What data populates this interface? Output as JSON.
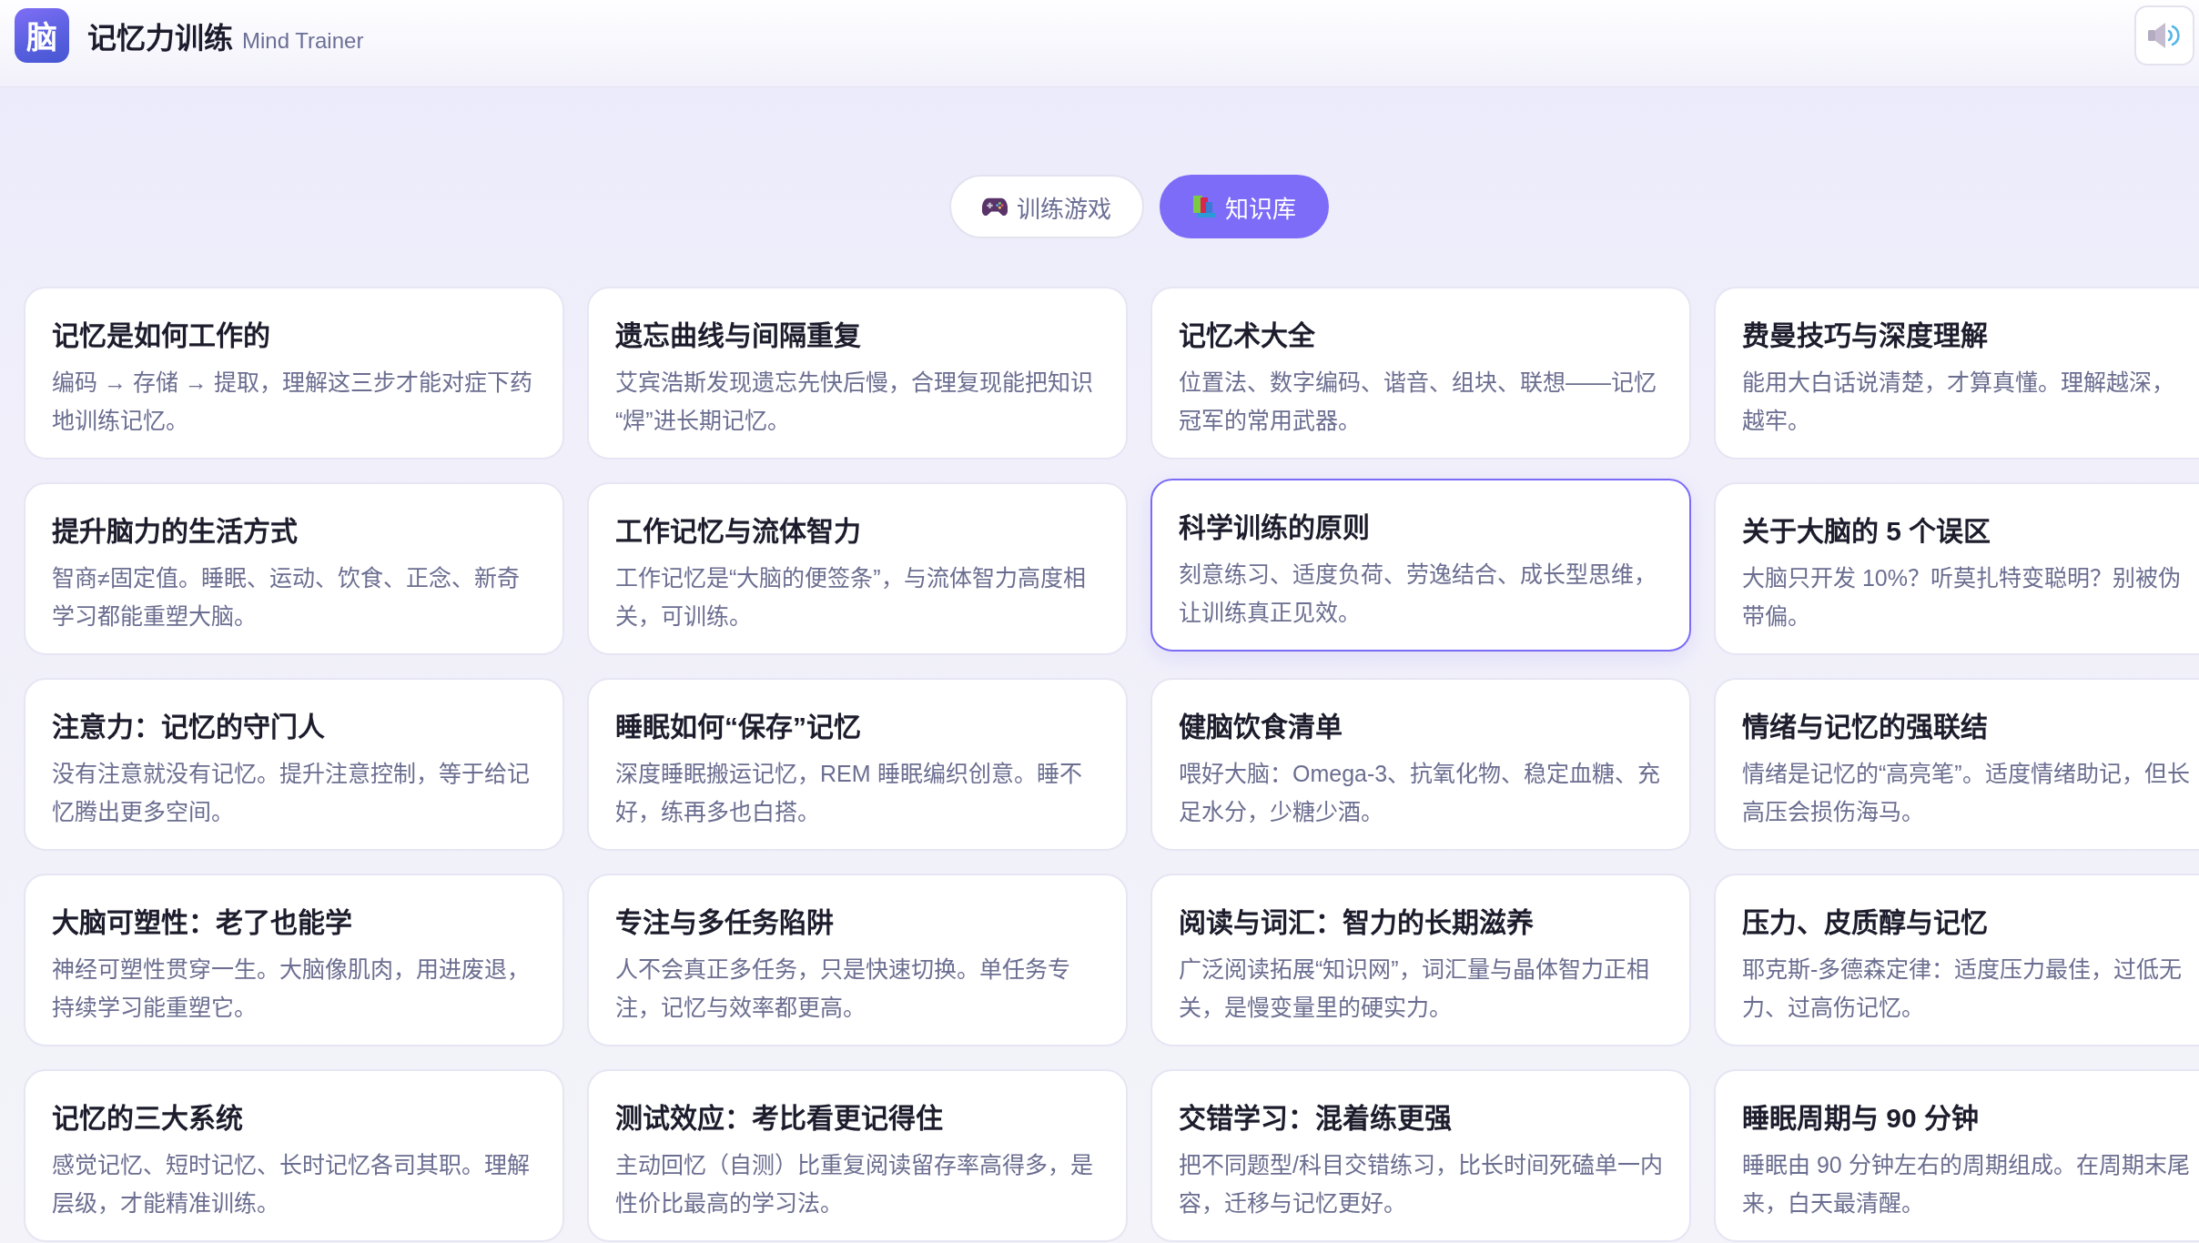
{
  "header": {
    "logo": "脑",
    "title": "记忆力训练",
    "subtitle": "Mind Trainer"
  },
  "tabs": [
    {
      "label": "训练游戏",
      "selected": false
    },
    {
      "label": "知识库",
      "selected": true
    }
  ],
  "cards": [
    {
      "title": "记忆是如何工作的",
      "description": [
        "编码 → 存储 → 提取，理解这三步才能对症下药地训练记忆。"
      ],
      "highlighted": false
    },
    {
      "title": "遗忘曲线与间隔重复",
      "description": [
        "艾宾浩斯发现遗忘先快后慢，合理复现能把知识“焊”进长期记忆。"
      ],
      "highlighted": false
    },
    {
      "title": "记忆术大全",
      "description": [
        "位置法、数字编码、谐音、组块、联想——记忆冠军的常用武器。"
      ],
      "highlighted": false
    },
    {
      "title": "费曼技巧与深度理解",
      "description": [
        "能用大白话说清楚，才算真懂。理解越深，",
        "越牢。"
      ],
      "highlighted": false
    },
    {
      "title": "提升脑力的生活方式",
      "description": [
        "智商≠固定值。睡眠、运动、饮食、正念、新奇学习都能重塑大脑。"
      ],
      "highlighted": false
    },
    {
      "title": "工作记忆与流体智力",
      "description": [
        "工作记忆是“大脑的便签条”，与流体智力高度相关，可训练。"
      ],
      "highlighted": false
    },
    {
      "title": "科学训练的原则",
      "description": [
        "刻意练习、适度负荷、劳逸结合、成长型思维，让训练真正见效。"
      ],
      "highlighted": true
    },
    {
      "title": "关于大脑的 5 个误区",
      "description": [
        "大脑只开发 10%？听莫扎特变聪明？别被伪",
        "带偏。"
      ],
      "highlighted": false
    },
    {
      "title": "注意力：记忆的守门人",
      "description": [
        "没有注意就没有记忆。提升注意控制，等于给记忆腾出更多空间。"
      ],
      "highlighted": false
    },
    {
      "title": "睡眠如何“保存”记忆",
      "description": [
        "深度睡眠搬运记忆，REM 睡眠编织创意。睡不好，练再多也白搭。"
      ],
      "highlighted": false
    },
    {
      "title": "健脑饮食清单",
      "description": [
        "喂好大脑：Omega-3、抗氧化物、稳定血糖、充足水分，少糖少酒。"
      ],
      "highlighted": false
    },
    {
      "title": "情绪与记忆的强联结",
      "description": [
        "情绪是记忆的“高亮笔”。适度情绪助记，但长",
        "高压会损伤海马。"
      ],
      "highlighted": false
    },
    {
      "title": "大脑可塑性：老了也能学",
      "description": [
        "神经可塑性贯穿一生。大脑像肌肉，用进废退，持续学习能重塑它。"
      ],
      "highlighted": false
    },
    {
      "title": "专注与多任务陷阱",
      "description": [
        "人不会真正多任务，只是快速切换。单任务专注，记忆与效率都更高。"
      ],
      "highlighted": false
    },
    {
      "title": "阅读与词汇：智力的长期滋养",
      "description": [
        "广泛阅读拓展“知识网”，词汇量与晶体智力正相关，是慢变量里的硬实力。"
      ],
      "highlighted": false
    },
    {
      "title": "压力、皮质醇与记忆",
      "description": [
        "耶克斯-多德森定律：适度压力最佳，过低无",
        "力、过高伤记忆。"
      ],
      "highlighted": false
    },
    {
      "title": "记忆的三大系统",
      "description": [
        "感觉记忆、短时记忆、长时记忆各司其职。理解层级，才能精准训练。"
      ],
      "highlighted": false
    },
    {
      "title": "测试效应：考比看更记得住",
      "description": [
        "主动回忆（自测）比重复阅读留存率高得多，是性价比最高的学习法。"
      ],
      "highlighted": false
    },
    {
      "title": "交错学习：混着练更强",
      "description": [
        "把不同题型/科目交错练习，比长时间死磕单一内容，迁移与记忆更好。"
      ],
      "highlighted": false
    },
    {
      "title": "睡眠周期与 90 分钟",
      "description": [
        "睡眠由 90 分钟左右的周期组成。在周期末尾",
        "来，白天最清醒。"
      ],
      "highlighted": false
    }
  ]
}
